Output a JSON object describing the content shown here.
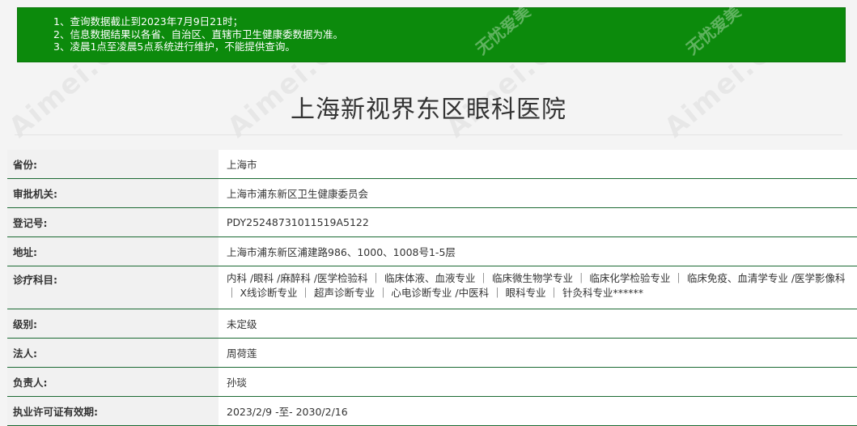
{
  "notice": {
    "lines": [
      "1、查询数据截止到2023年7月9日21时；",
      "2、信息数据结果以各省、自治区、直辖市卫生健康委数据为准。",
      "3、凌晨1点至凌晨5点系统进行维护，不能提供查询。"
    ]
  },
  "title": "上海新视界东区眼科医院",
  "rows": [
    {
      "label": "省份:",
      "value": "上海市"
    },
    {
      "label": "审批机关:",
      "value": "上海市浦东新区卫生健康委员会"
    },
    {
      "label": "登记号:",
      "value": "PDY25248731011519A5122"
    },
    {
      "label": "地址:",
      "value": "上海市浦东新区浦建路986、1000、1008号1-5层"
    },
    {
      "label": "诊疗科目:",
      "value": "内科 /眼科 /麻醉科 /医学检验科 ｜ 临床体液、血液专业 ｜ 临床微生物学专业 ｜ 临床化学检验专业 ｜ 临床免疫、血清学专业 /医学影像科 ｜ X线诊断专业 ｜ 超声诊断专业 ｜ 心电诊断专业 /中医科 ｜ 眼科专业 ｜ 针灸科专业******"
    },
    {
      "label": "级别:",
      "value": "未定级"
    },
    {
      "label": "法人:",
      "value": "周荷莲"
    },
    {
      "label": "负责人:",
      "value": "孙琰"
    },
    {
      "label": "执业许可证有效期:",
      "value": "2023/2/9 -至- 2030/2/16"
    }
  ],
  "watermark": {
    "brand": "Aimei.COM",
    "cn": "无忧爱美"
  }
}
